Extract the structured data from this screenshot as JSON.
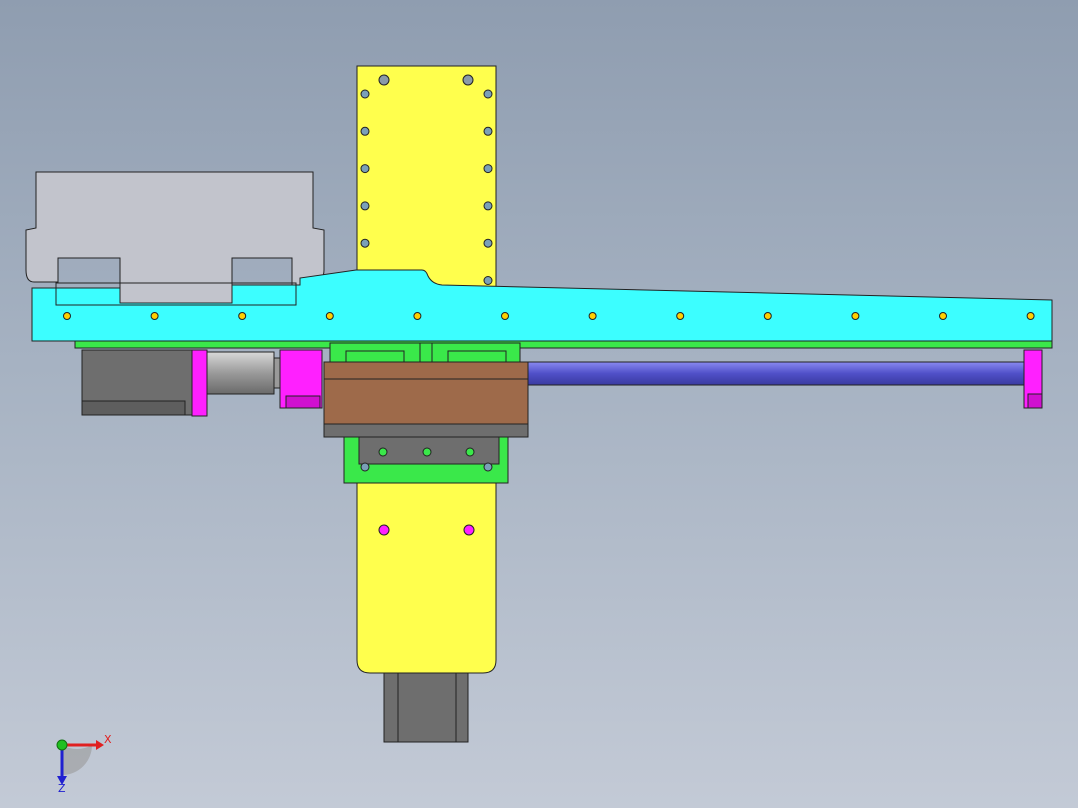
{
  "viewport": {
    "background_top": "#8f9db0",
    "background_bottom": "#c3cad6"
  },
  "colors": {
    "yellow_plate": "#ffff4d",
    "cyan_beam": "#3cfeff",
    "green_rail": "#3ae84a",
    "magenta_bracket": "#ff20ff",
    "brown_carriage": "#9e6a4a",
    "grey_motor": "#6e6e6e",
    "grey_cover": "#c2c4cc",
    "blue_rod": "#5a5ad8"
  },
  "triad": {
    "x_label": "X",
    "z_label": "Z",
    "icon": "axis-triad-icon"
  }
}
